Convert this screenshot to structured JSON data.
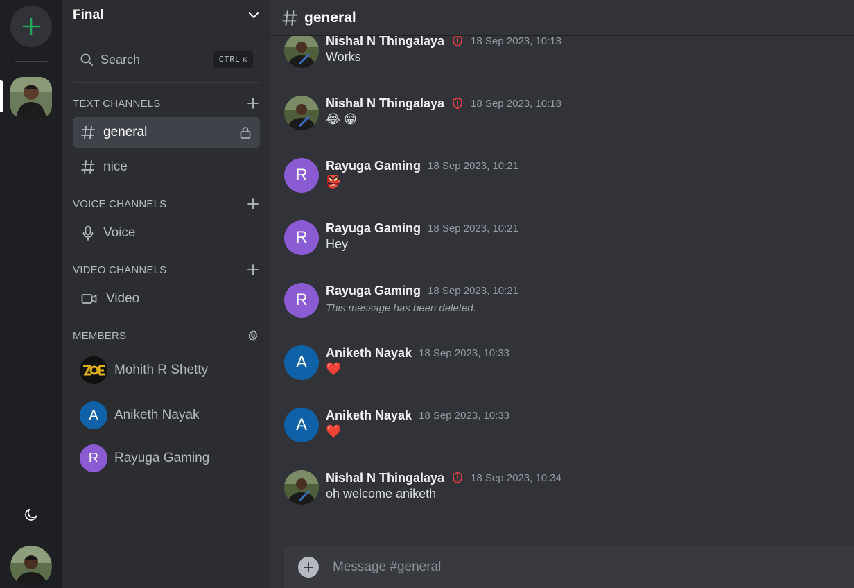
{
  "server": {
    "name": "Final"
  },
  "sidebar": {
    "search_label": "Search",
    "search_shortcut": "CTRL",
    "search_shortcut_key": "K",
    "sections": {
      "text": "TEXT CHANNELS",
      "voice": "VOICE CHANNELS",
      "video": "VIDEO CHANNELS",
      "members": "MEMBERS"
    },
    "text_channels": [
      {
        "label": "general",
        "active": true
      },
      {
        "label": "nice",
        "active": false
      }
    ],
    "voice_channels": [
      {
        "label": "Voice"
      }
    ],
    "video_channels": [
      {
        "label": "Video"
      }
    ],
    "members": [
      {
        "name": "Mohith R Shetty",
        "initial": "",
        "color": "#1a1a1a"
      },
      {
        "name": "Aniketh Nayak",
        "initial": "A",
        "color": "#0f62a8"
      },
      {
        "name": "Rayuga Gaming",
        "initial": "R",
        "color": "#8b5bd3"
      }
    ]
  },
  "chat": {
    "channel_name": "general",
    "composer_placeholder": "Message #general",
    "messages": [
      {
        "author": "Nishal N Thingalaya",
        "admin": true,
        "time": "18 Sep 2023, 10:18",
        "text": "Works",
        "avatar": "photo"
      },
      {
        "author": "Nishal N Thingalaya",
        "admin": true,
        "time": "18 Sep 2023, 10:18",
        "text": "😂 😁",
        "avatar": "photo"
      },
      {
        "author": "Rayuga Gaming",
        "admin": false,
        "time": "18 Sep 2023, 10:21",
        "text": "👺",
        "avatar": "R"
      },
      {
        "author": "Rayuga Gaming",
        "admin": false,
        "time": "18 Sep 2023, 10:21",
        "text": "Hey",
        "avatar": "R"
      },
      {
        "author": "Rayuga Gaming",
        "admin": false,
        "time": "18 Sep 2023, 10:21",
        "text": "This message has been deleted.",
        "avatar": "R",
        "deleted": true
      },
      {
        "author": "Aniketh Nayak",
        "admin": false,
        "time": "18 Sep 2023, 10:33",
        "text": "❤️",
        "avatar": "A"
      },
      {
        "author": "Aniketh Nayak",
        "admin": false,
        "time": "18 Sep 2023, 10:33",
        "text": "❤️",
        "avatar": "A"
      },
      {
        "author": "Nishal N Thingalaya",
        "admin": true,
        "time": "18 Sep 2023, 10:34",
        "text": "oh welcome aniketh",
        "avatar": "photo"
      }
    ]
  },
  "colors": {
    "accent_green": "#23a55a",
    "admin_red": "#f23f42",
    "avatar_purple": "#8b5bd3",
    "avatar_blue": "#0f62a8"
  },
  "icons": {
    "add_server": "plus-icon",
    "theme": "moon-icon",
    "dropdown": "chevron-down-icon",
    "search": "search-icon",
    "text_channel": "hash-icon",
    "voice": "mic-icon",
    "video": "video-icon",
    "lock": "lock-icon",
    "settings": "gear-icon",
    "admin": "shield-alert-icon"
  }
}
